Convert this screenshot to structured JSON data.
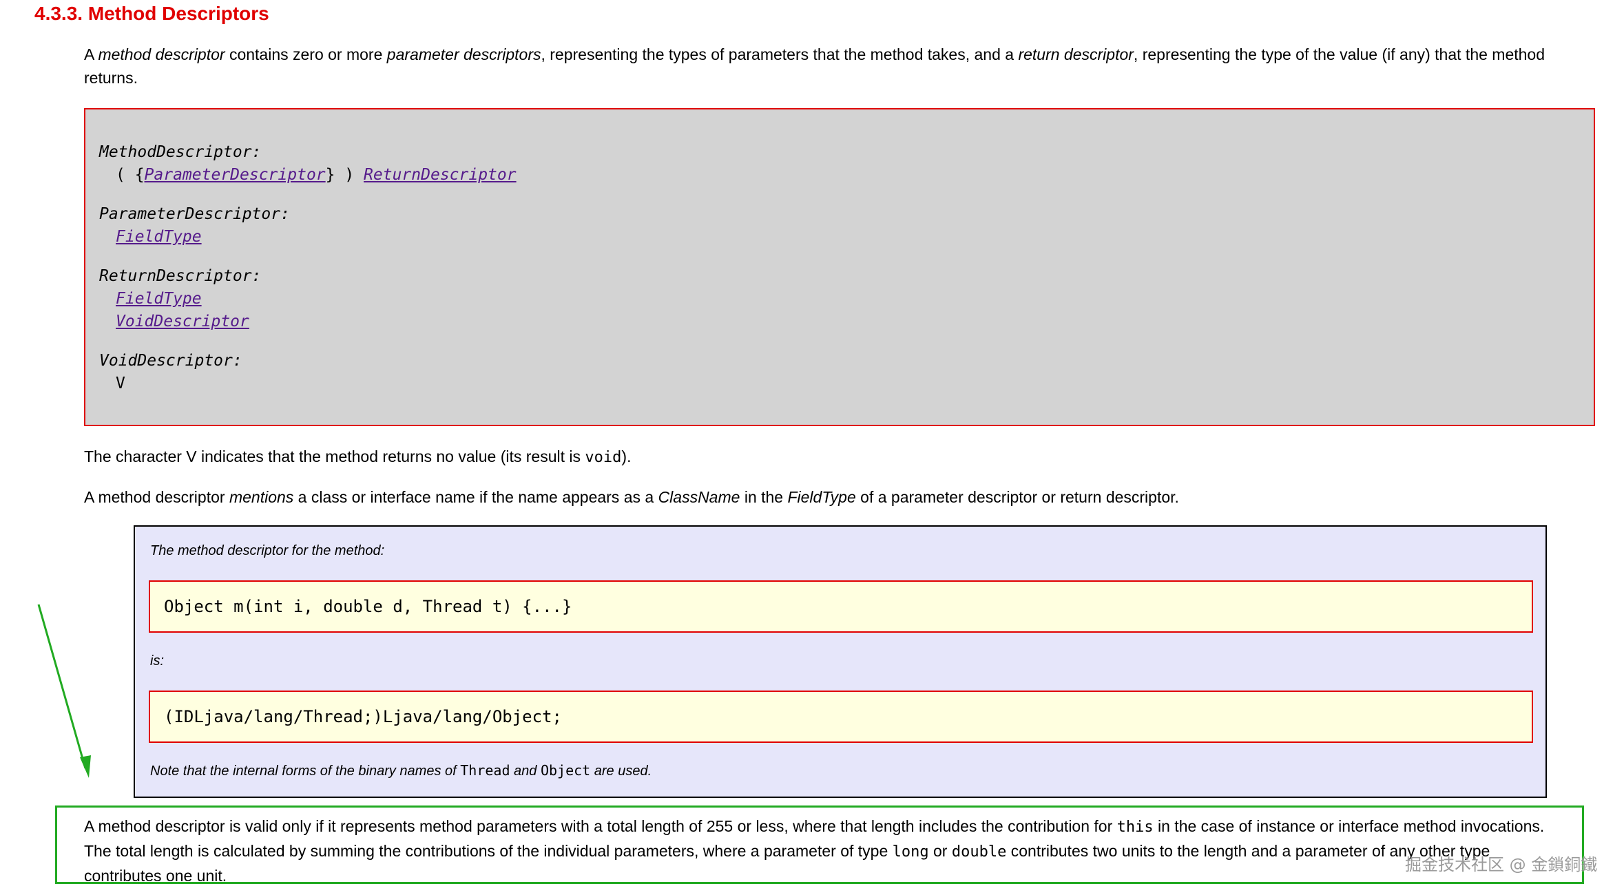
{
  "section": {
    "title": "4.3.3. Method Descriptors"
  },
  "intro": {
    "p1": "A ",
    "e1": "method descriptor",
    "p2": " contains zero or more ",
    "e2": "parameter descriptors",
    "p3": ", representing the types of parameters that the method takes, and a ",
    "e3": "return descriptor",
    "p4": ", representing the type of the value (if any) that the method returns."
  },
  "grammar": {
    "method_descriptor": {
      "lhs": "MethodDescriptor:",
      "open": "( {",
      "param_link": "ParameterDescriptor",
      "close": "} ) ",
      "return_link": "ReturnDescriptor"
    },
    "parameter_descriptor": {
      "lhs": "ParameterDescriptor:",
      "rhs_link": "FieldType"
    },
    "return_descriptor": {
      "lhs": "ReturnDescriptor:",
      "rhs_link_1": "FieldType",
      "rhs_link_2": "VoidDescriptor"
    },
    "void_descriptor": {
      "lhs": "VoidDescriptor:",
      "rhs": "V"
    }
  },
  "void_para": {
    "p1": "The character V indicates that the method returns no value (its result is ",
    "code": "void",
    "p2": ")."
  },
  "mentions_para": {
    "p1": "A method descriptor ",
    "e1": "mentions",
    "p2": " a class or interface name if the name appears as a ",
    "e2": "ClassName",
    "p3": " in the ",
    "e3": "FieldType",
    "p4": " of a parameter descriptor or return descriptor."
  },
  "example": {
    "caption": "The method descriptor for the method:",
    "code1": "Object m(int i, double d, Thread t) {...}",
    "is_label": "is:",
    "code2": "(IDLjava/lang/Thread;)Ljava/lang/Object;",
    "note_p1": "Note that the internal forms of the binary names of ",
    "note_c1": "Thread",
    "note_p2": " and ",
    "note_c2": "Object",
    "note_p3": " are used."
  },
  "validity_para": {
    "p1": "A method descriptor is valid only if it represents method parameters with a total length of 255 or less, where that length includes the contribution for ",
    "c1": "this",
    "p2": " in the case of instance or interface method invocations. The total length is calculated by summing the contributions of the individual parameters, where a parameter of type ",
    "c2": "long",
    "p3": " or ",
    "c3": "double",
    "p4": " contributes two units to the length and a parameter of any other type contributes one unit."
  },
  "watermark": {
    "text": "掘金技术社区 @ 金鎖銅鐵"
  },
  "colors": {
    "title_red": "#e00000",
    "grammar_bg": "#d3d3d3",
    "example_bg": "#e6e6fa",
    "code_bg": "#ffffe0",
    "link_purple": "#551a8b",
    "annotation_green": "#22aa22"
  }
}
